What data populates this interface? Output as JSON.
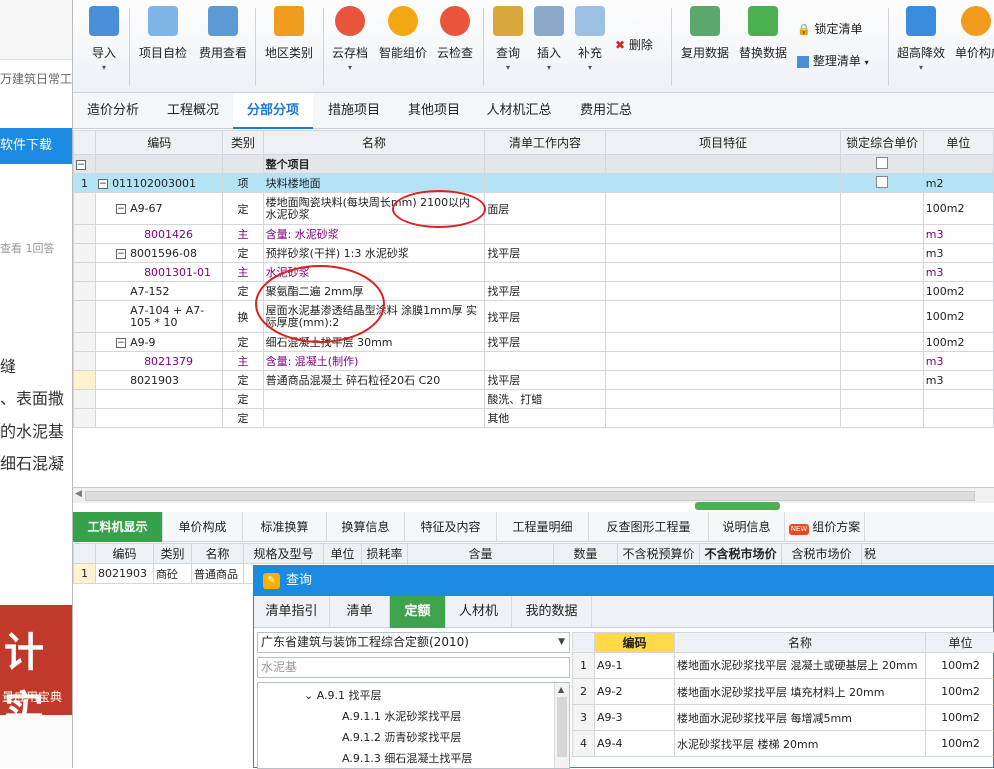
{
  "left_panel": {
    "title": "万建筑日常工",
    "download": "软件下载",
    "meta": "查看  1回答",
    "lines": [
      "缝",
      "、表面撒",
      "的水泥基",
      "细石混凝"
    ],
    "banner": {
      "big": "计 实",
      "small": "量应用宝典"
    }
  },
  "ribbon": {
    "buttons": [
      {
        "label": "导入",
        "arrow": "▾"
      },
      {
        "label": "项目自检"
      },
      {
        "label": "费用查看"
      },
      {
        "label": "地区类别"
      },
      {
        "label": "云存档",
        "arrow": "▾"
      },
      {
        "label": "智能组价"
      },
      {
        "label": "云检查"
      },
      {
        "label": "查询",
        "arrow": "▾"
      },
      {
        "label": "插入",
        "arrow": "▾"
      },
      {
        "label": "补充",
        "arrow": "▾"
      },
      {
        "label": "删除"
      },
      {
        "label": "复用数据"
      },
      {
        "label": "替换数据"
      },
      {
        "label": "锁定清单"
      },
      {
        "label": "整理清单"
      },
      {
        "label": "超高降效",
        "arrow": "▾"
      },
      {
        "label": "单价构成"
      }
    ],
    "delete_symbol": "✖",
    "lock_symbol": "🔒"
  },
  "tabs": [
    "造价分析",
    "工程概况",
    "分部分项",
    "措施项目",
    "其他项目",
    "人材机汇总",
    "费用汇总"
  ],
  "active_tab": "分部分项",
  "grid": {
    "headers": [
      "",
      "编码",
      "类别",
      "名称",
      "清单工作内容",
      "项目特征",
      "锁定综合单价",
      "单位"
    ],
    "rows": [
      {
        "num": "",
        "code": "",
        "cat": "",
        "name": "整个项目",
        "work": "",
        "feature": "",
        "lock": true,
        "unit": ""
      },
      {
        "num": "1",
        "code": "011102003001",
        "cat": "项",
        "name": "块料楼地面",
        "work": "",
        "feature": "",
        "lock": true,
        "unit": "m2"
      },
      {
        "num": "",
        "code": "A9-67",
        "cat": "定",
        "name": "楼地面陶瓷块料(每块周长mm) 2100以内 水泥砂浆",
        "work": "面层",
        "feature": "",
        "unit": "100m2"
      },
      {
        "num": "",
        "code": "8001426",
        "cat": "主",
        "name": "含量: 水泥砂浆",
        "work": "",
        "feature": "",
        "unit": "m3"
      },
      {
        "num": "",
        "code": "8001596-08",
        "cat": "定",
        "name": "预拌砂浆(干拌) 1:3 水泥砂浆",
        "work": "找平层",
        "feature": "",
        "unit": "m3"
      },
      {
        "num": "",
        "code": "8001301-01",
        "cat": "主",
        "name": "水泥砂浆",
        "work": "",
        "feature": "",
        "unit": "m3"
      },
      {
        "num": "",
        "code": "A7-152",
        "cat": "定",
        "name": "聚氨酯二遍 2mm厚",
        "work": "找平层",
        "feature": "",
        "unit": "100m2"
      },
      {
        "num": "",
        "code": "A7-104 + A7-105 * 10",
        "cat": "换",
        "name": "屋面水泥基渗透结晶型涂料 涂膜1mm厚 实际厚度(mm):2",
        "work": "找平层",
        "feature": "",
        "unit": "100m2"
      },
      {
        "num": "",
        "code": "A9-9",
        "cat": "定",
        "name": "细石混凝土找平层 30mm",
        "work": "找平层",
        "feature": "",
        "unit": "100m2"
      },
      {
        "num": "",
        "code": "8021379",
        "cat": "主",
        "name": "含量: 混凝土(制作)",
        "work": "",
        "feature": "",
        "unit": "m3"
      },
      {
        "num": "",
        "code": "8021903",
        "cat": "定",
        "name": "普通商品混凝土 碎石粒径20石 C20",
        "work": "找平层",
        "feature": "",
        "unit": "m3"
      },
      {
        "num": "",
        "code": "",
        "cat": "定",
        "name": "",
        "work": "酸洗、打蜡",
        "feature": "",
        "unit": ""
      },
      {
        "num": "",
        "code": "",
        "cat": "定",
        "name": "",
        "work": "其他",
        "feature": "",
        "unit": ""
      }
    ]
  },
  "bottom_tabs": [
    "工料机显示",
    "单价构成",
    "标准换算",
    "换算信息",
    "特征及内容",
    "工程量明细",
    "反查图形工程量",
    "说明信息",
    "组价方案"
  ],
  "new_badge": "NEW",
  "grid2": {
    "headers": [
      "",
      "编码",
      "类别",
      "名称",
      "规格及型号",
      "单位",
      "损耗率",
      "含量",
      "数量",
      "不含税预算价",
      "不含税市场价",
      "含税市场价",
      "税"
    ],
    "row": [
      "1",
      "8021903",
      "商砼",
      "普通商品",
      "",
      "",
      "",
      "",
      "",
      "",
      "",
      "",
      ""
    ]
  },
  "dialog": {
    "title": "查询",
    "tabs": [
      "清单指引",
      "清单",
      "定额",
      "人材机",
      "我的数据"
    ],
    "active_tab": "定额",
    "library": "广东省建筑与装饰工程综合定额(2010)",
    "search": "水泥基",
    "tree": [
      {
        "label": "A.9.1 找平层",
        "arrow": "⌄"
      },
      {
        "label": "A.9.1.1 水泥砂浆找平层"
      },
      {
        "label": "A.9.1.2 沥青砂浆找平层"
      },
      {
        "label": "A.9.1.3 细石混凝土找平层"
      }
    ],
    "grid_headers": [
      "",
      "编码",
      "名称",
      "单位"
    ],
    "rows": [
      {
        "num": "1",
        "code": "A9-1",
        "name": "楼地面水泥砂浆找平层 混凝土或硬基层上 20mm",
        "unit": "100m2"
      },
      {
        "num": "2",
        "code": "A9-2",
        "name": "楼地面水泥砂浆找平层 填充材料上 20mm",
        "unit": "100m2"
      },
      {
        "num": "3",
        "code": "A9-3",
        "name": "楼地面水泥砂浆找平层 每增减5mm",
        "unit": "100m2"
      },
      {
        "num": "4",
        "code": "A9-4",
        "name": "水泥砂浆找平层 楼梯 20mm",
        "unit": "100m2"
      }
    ]
  },
  "colors": {
    "accent": "#1a8be0",
    "active_tab_green": "#37a04a",
    "selected_row": "#b4e3f5",
    "annotation": "#e02020",
    "highlight": "#ffd94a"
  }
}
